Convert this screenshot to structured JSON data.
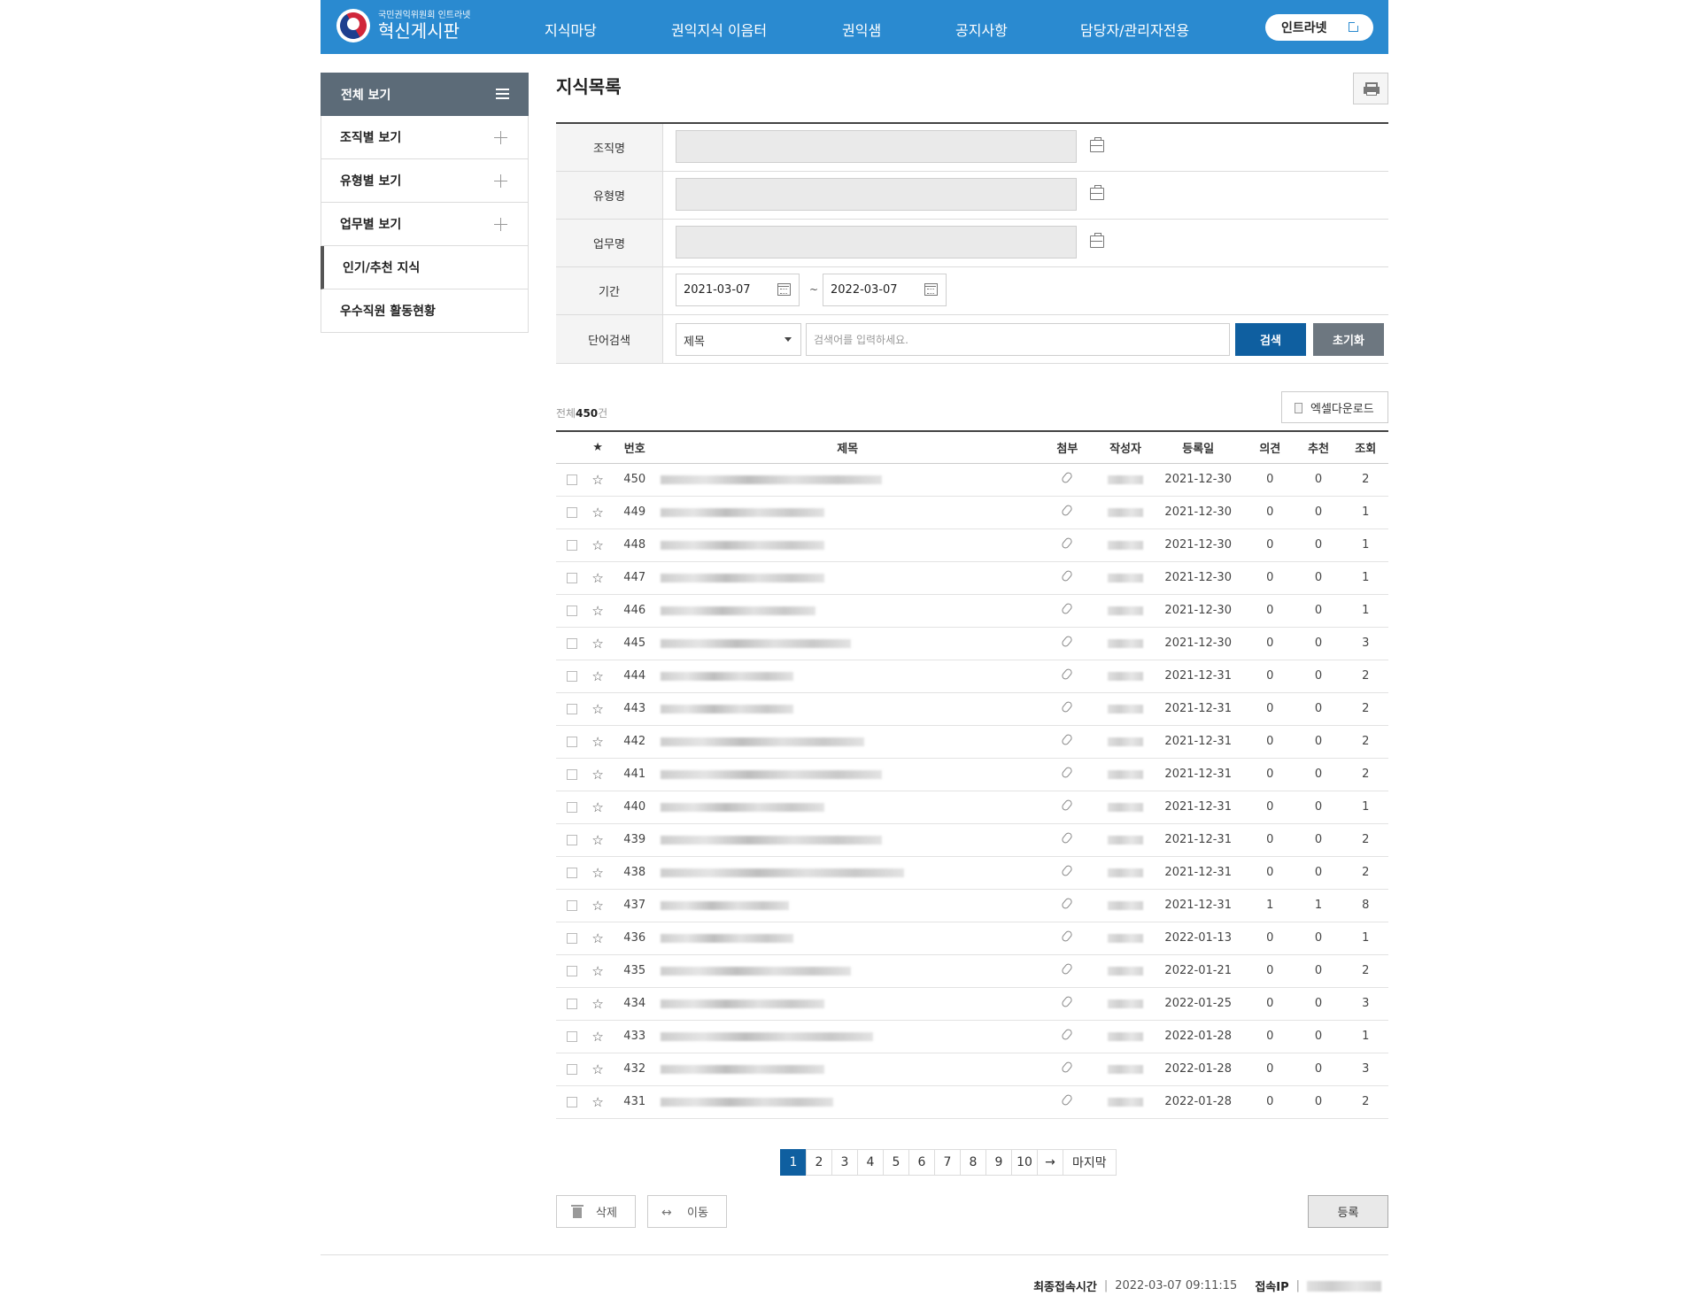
{
  "header": {
    "logo_sub": "국민권익위원회 인트라넷",
    "logo_main": "혁신게시판",
    "nav": [
      "지식마당",
      "권익지식 이음터",
      "권익샘",
      "공지사항",
      "담당자/관리자전용"
    ],
    "intranet_label": "인트라넷",
    "brand_color": "#2a8ad0"
  },
  "sidebar": {
    "head_label": "전체 보기",
    "items": [
      {
        "label": "조직별 보기",
        "expandable": true
      },
      {
        "label": "유형별 보기",
        "expandable": true
      },
      {
        "label": "업무별 보기",
        "expandable": true
      },
      {
        "label": "인기/추천 지식",
        "expandable": false,
        "active": true
      },
      {
        "label": "우수직원 활동현황",
        "expandable": false
      }
    ]
  },
  "page": {
    "title": "지식목록"
  },
  "search": {
    "org_label": "조직명",
    "type_label": "유형명",
    "task_label": "업무명",
    "period_label": "기간",
    "date_from": "2021-03-07",
    "date_sep": "~",
    "date_to": "2022-03-07",
    "keyword_label": "단어검색",
    "select_value": "제목",
    "keyword_placeholder": "검색어를 입력하세요.",
    "search_button": "검색",
    "reset_button": "초기화"
  },
  "list": {
    "total_prefix": "전체",
    "total_count": "450",
    "total_suffix": "건",
    "excel_button": "엑셀다운로드",
    "columns": {
      "star": "★",
      "no": "번호",
      "title": "제목",
      "attach": "첨부",
      "author": "작성자",
      "date": "등록일",
      "opinion": "의견",
      "recommend": "추천",
      "views": "조회"
    },
    "rows": [
      {
        "no": "450",
        "date": "2021-12-30",
        "opinion": "0",
        "recommend": "0",
        "views": "2",
        "title_len": 250
      },
      {
        "no": "449",
        "date": "2021-12-30",
        "opinion": "0",
        "recommend": "0",
        "views": "1",
        "title_len": 185
      },
      {
        "no": "448",
        "date": "2021-12-30",
        "opinion": "0",
        "recommend": "0",
        "views": "1",
        "title_len": 185
      },
      {
        "no": "447",
        "date": "2021-12-30",
        "opinion": "0",
        "recommend": "0",
        "views": "1",
        "title_len": 185
      },
      {
        "no": "446",
        "date": "2021-12-30",
        "opinion": "0",
        "recommend": "0",
        "views": "1",
        "title_len": 175
      },
      {
        "no": "445",
        "date": "2021-12-30",
        "opinion": "0",
        "recommend": "0",
        "views": "3",
        "title_len": 215
      },
      {
        "no": "444",
        "date": "2021-12-31",
        "opinion": "0",
        "recommend": "0",
        "views": "2",
        "title_len": 150
      },
      {
        "no": "443",
        "date": "2021-12-31",
        "opinion": "0",
        "recommend": "0",
        "views": "2",
        "title_len": 150
      },
      {
        "no": "442",
        "date": "2021-12-31",
        "opinion": "0",
        "recommend": "0",
        "views": "2",
        "title_len": 230
      },
      {
        "no": "441",
        "date": "2021-12-31",
        "opinion": "0",
        "recommend": "0",
        "views": "2",
        "title_len": 250
      },
      {
        "no": "440",
        "date": "2021-12-31",
        "opinion": "0",
        "recommend": "0",
        "views": "1",
        "title_len": 185
      },
      {
        "no": "439",
        "date": "2021-12-31",
        "opinion": "0",
        "recommend": "0",
        "views": "2",
        "title_len": 250
      },
      {
        "no": "438",
        "date": "2021-12-31",
        "opinion": "0",
        "recommend": "0",
        "views": "2",
        "title_len": 275
      },
      {
        "no": "437",
        "date": "2021-12-31",
        "opinion": "1",
        "recommend": "1",
        "views": "8",
        "title_len": 145
      },
      {
        "no": "436",
        "date": "2022-01-13",
        "opinion": "0",
        "recommend": "0",
        "views": "1",
        "title_len": 150
      },
      {
        "no": "435",
        "date": "2022-01-21",
        "opinion": "0",
        "recommend": "0",
        "views": "2",
        "title_len": 215
      },
      {
        "no": "434",
        "date": "2022-01-25",
        "opinion": "0",
        "recommend": "0",
        "views": "3",
        "title_len": 185
      },
      {
        "no": "433",
        "date": "2022-01-28",
        "opinion": "0",
        "recommend": "0",
        "views": "1",
        "title_len": 240
      },
      {
        "no": "432",
        "date": "2022-01-28",
        "opinion": "0",
        "recommend": "0",
        "views": "3",
        "title_len": 185
      },
      {
        "no": "431",
        "date": "2022-01-28",
        "opinion": "0",
        "recommend": "0",
        "views": "2",
        "title_len": 195
      }
    ]
  },
  "pagination": {
    "pages": [
      "1",
      "2",
      "3",
      "4",
      "5",
      "6",
      "7",
      "8",
      "9",
      "10"
    ],
    "current": "1",
    "next_label": "→",
    "last_label": "마지막"
  },
  "actions": {
    "delete_label": "삭제",
    "move_label": "이동",
    "register_label": "등록"
  },
  "footer": {
    "last_access_label": "최종접속시간",
    "last_access_value": "2022-03-07 09:11:15",
    "ip_label": "접속IP"
  }
}
